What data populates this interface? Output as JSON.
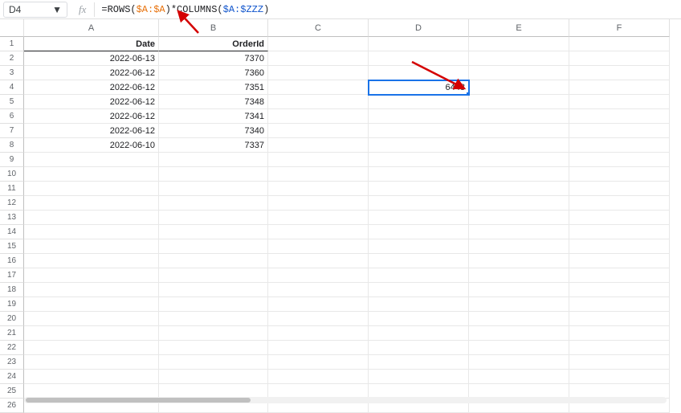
{
  "formula_bar": {
    "cell_ref": "D4",
    "fx_label": "fx",
    "formula_prefix": "=ROWS(",
    "formula_arg1": "$A:$A",
    "formula_mid": ")*COLUMNS(",
    "formula_arg2": "$A:$ZZZ",
    "formula_suffix": ")"
  },
  "columns": [
    "A",
    "B",
    "C",
    "D",
    "E",
    "F"
  ],
  "row_numbers": [
    "1",
    "2",
    "3",
    "4",
    "5",
    "6",
    "7",
    "8",
    "9",
    "10",
    "11",
    "12",
    "13",
    "14",
    "15",
    "16",
    "17",
    "18",
    "19",
    "20",
    "21",
    "22",
    "23",
    "24",
    "25",
    "26"
  ],
  "header_row": {
    "A": "Date",
    "B": "OrderId"
  },
  "rows": [
    {
      "date": "2022-06-13",
      "order": "7370"
    },
    {
      "date": "2022-06-12",
      "order": "7360"
    },
    {
      "date": "2022-06-12",
      "order": "7351"
    },
    {
      "date": "2022-06-12",
      "order": "7348"
    },
    {
      "date": "2022-06-12",
      "order": "7341"
    },
    {
      "date": "2022-06-12",
      "order": "7340"
    },
    {
      "date": "2022-06-10",
      "order": "7337"
    }
  ],
  "selected_cell_value": "6448"
}
